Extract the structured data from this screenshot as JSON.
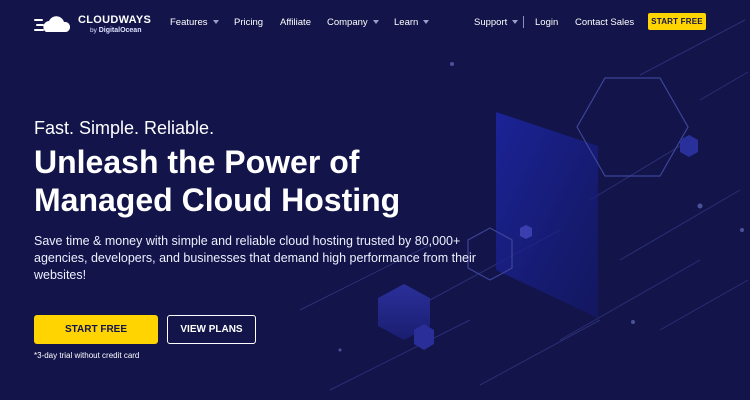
{
  "brand": {
    "name": "CLOUDWAYS",
    "by": "by",
    "parent": "DigitalOcean"
  },
  "nav": {
    "items": [
      {
        "label": "Features",
        "dropdown": true
      },
      {
        "label": "Pricing",
        "dropdown": false
      },
      {
        "label": "Affiliate",
        "dropdown": false
      },
      {
        "label": "Company",
        "dropdown": true
      },
      {
        "label": "Learn",
        "dropdown": true
      }
    ],
    "right_items": [
      {
        "label": "Support",
        "dropdown": true
      },
      {
        "label": "Login",
        "dropdown": false
      },
      {
        "label": "Contact Sales",
        "dropdown": false
      }
    ],
    "cta_label": "START FREE"
  },
  "hero": {
    "tagline": "Fast. Simple. Reliable.",
    "headline_line1": "Unleash the Power of",
    "headline_line2": "Managed Cloud Hosting",
    "description": "Save time & money with simple and reliable cloud hosting trusted by 80,000+ agencies, developers, and businesses that demand high performance from their websites!",
    "primary_cta": "START FREE",
    "secondary_cta": "VIEW PLANS",
    "trial_note": "*3-day trial without credit card"
  },
  "colors": {
    "background": "#12144a",
    "accent": "#ffd400",
    "text": "#ffffff"
  }
}
